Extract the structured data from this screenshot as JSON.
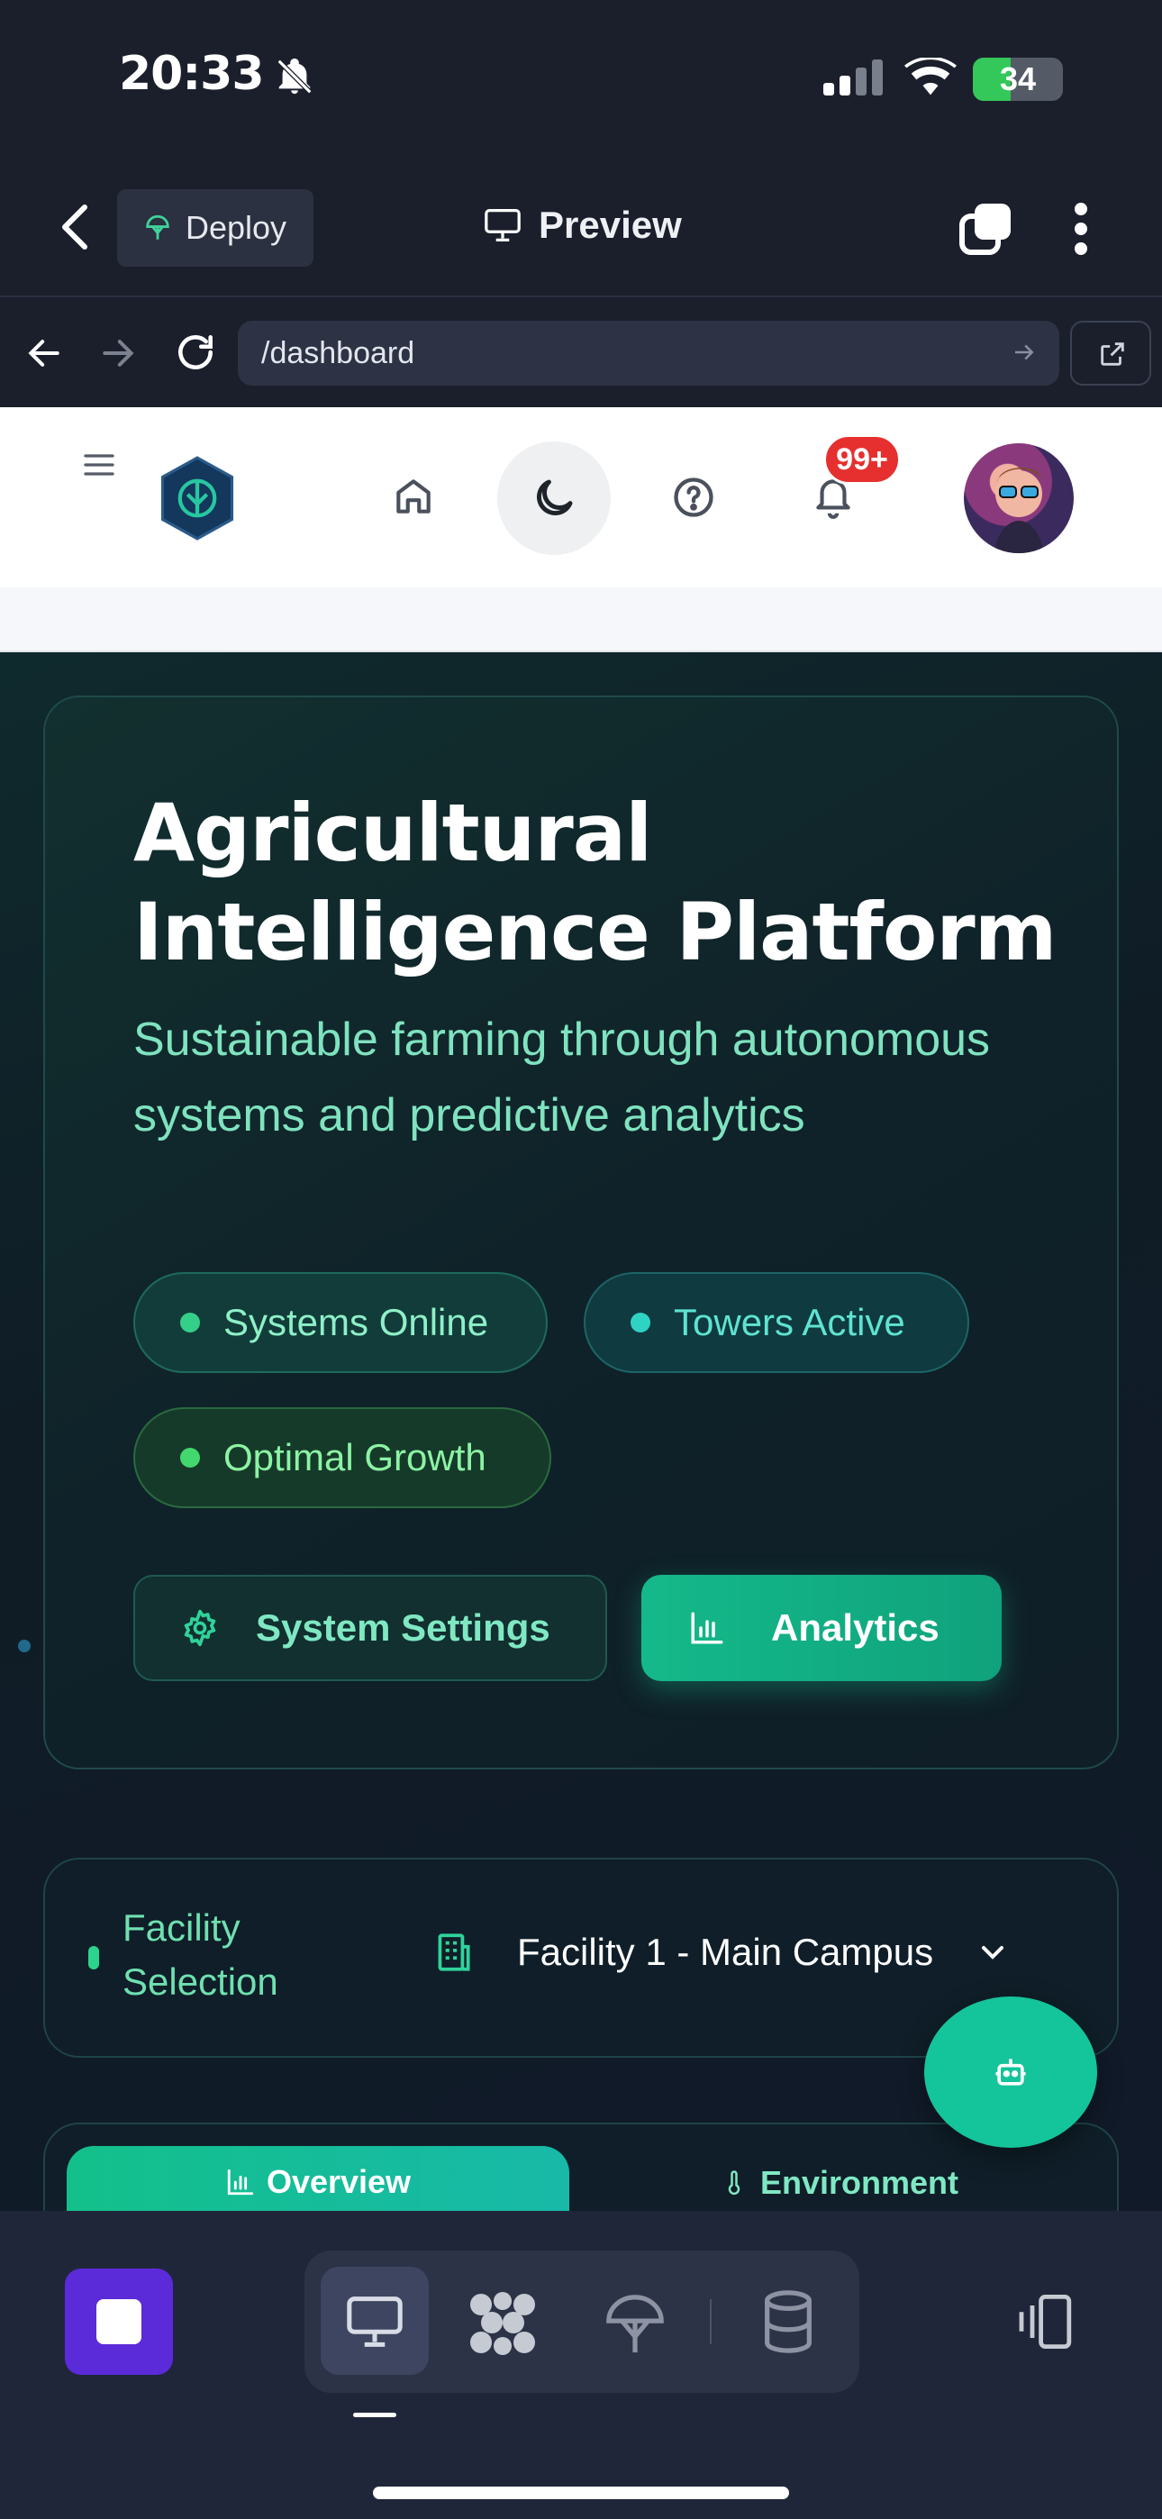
{
  "status_bar": {
    "time": "20:33",
    "battery": "34"
  },
  "app_bar": {
    "deploy_label": "Deploy",
    "preview_label": "Preview"
  },
  "browser": {
    "url": "/dashboard"
  },
  "web_header": {
    "notification_badge": "99+"
  },
  "hero": {
    "title": "Agricultural Intelligence Platform",
    "subtitle": "Sustainable farming through autonomous systems and predictive analytics",
    "pills": [
      "Systems Online",
      "Towers Active",
      "Optimal Growth"
    ],
    "settings_button": "System Settings",
    "analytics_button": "Analytics"
  },
  "facility": {
    "label": "Facility Selection",
    "selected": "Facility 1 - Main Campus"
  },
  "tabs": {
    "overview": "Overview",
    "environment": "Environment"
  },
  "colors": {
    "accent": "#14b98a",
    "stop_button": "#5b2bd9",
    "badge": "#e5302f"
  }
}
